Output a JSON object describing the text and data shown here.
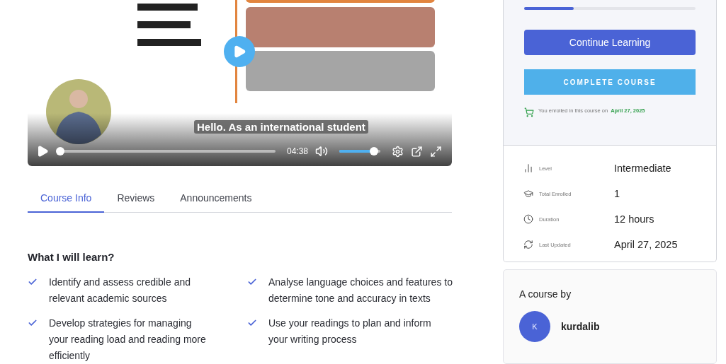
{
  "video": {
    "kind": "picture",
    "caption": "Hello. As an international student",
    "time": "04:38",
    "progress": {
      "level": 0.0
    },
    "volume": {
      "level": 0.85
    }
  },
  "tabs": [
    {
      "label": "Course Info",
      "selected": true
    },
    {
      "label": "Reviews",
      "selected": false
    },
    {
      "label": "Announcements",
      "selected": false
    }
  ],
  "learn": {
    "heading": "What I will learn?",
    "items": [
      "Identify and assess credible and relevant academic sources",
      "Analyse language choices and features to determine tone and accuracy in texts",
      "Develop strategies for managing your reading load and reading more efficiently",
      "Use your readings to plan and inform your writing process"
    ]
  },
  "enrollment": {
    "progress": {
      "level": 0.29
    },
    "continue_button": "Continue Learning",
    "complete_button": "COMPLETE COURSE",
    "enrolled_text": "You enrolled in this course on",
    "enrolled_date": "April 27, 2025"
  },
  "details": [
    {
      "kind": "level",
      "label": "Level",
      "value": "Intermediate"
    },
    {
      "kind": "enrolled",
      "label": "Total Enrolled",
      "value": "1"
    },
    {
      "kind": "duration",
      "label": "Duration",
      "value": "12 hours"
    },
    {
      "kind": "updated",
      "label": "Last Updated",
      "value": "April 27, 2025"
    }
  ],
  "author": {
    "heading": "A course by",
    "initial": "K",
    "name": "kurdalib"
  }
}
